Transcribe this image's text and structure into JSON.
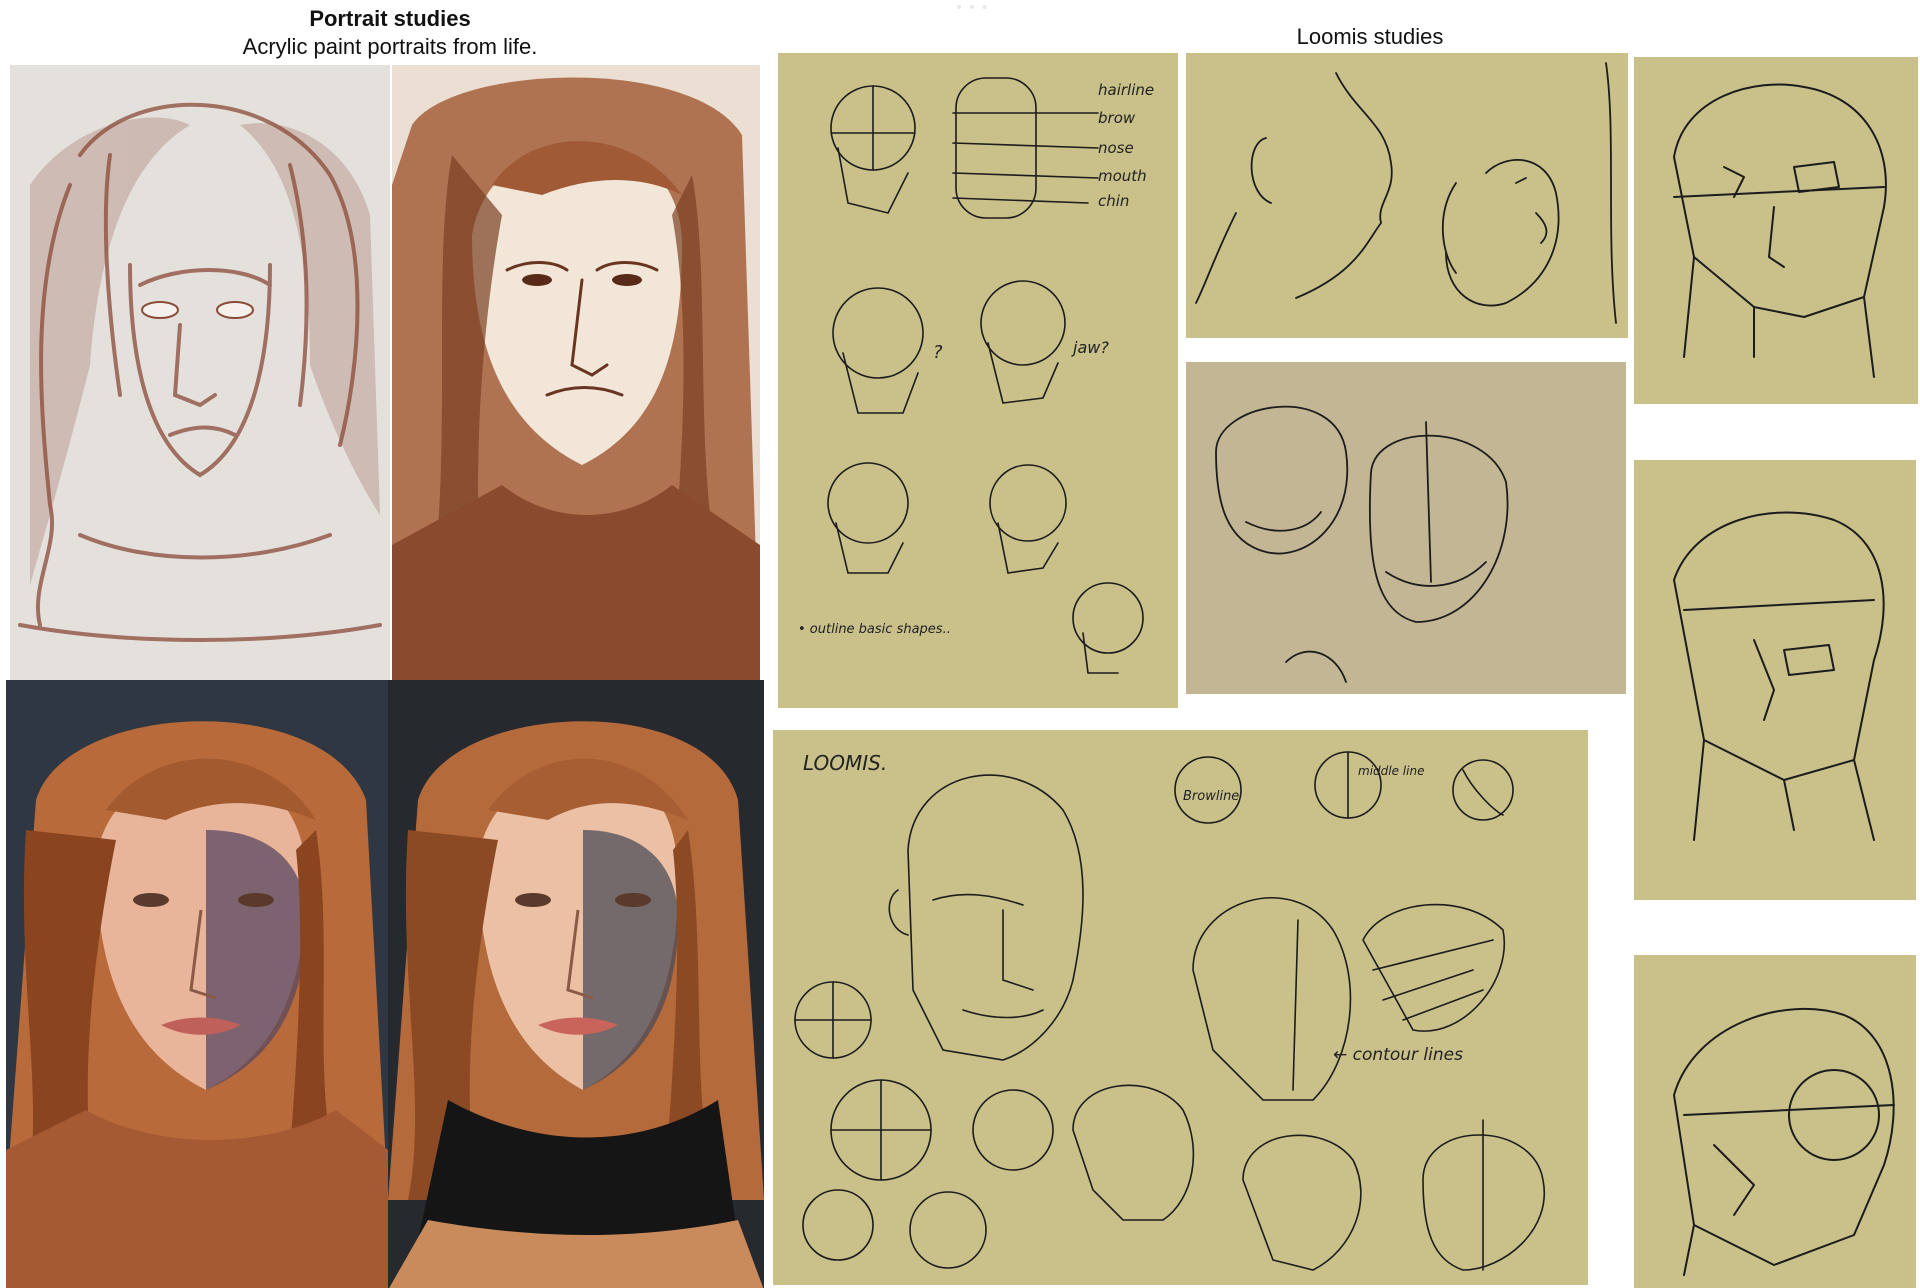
{
  "portrait_section": {
    "title": "Portrait studies",
    "subtitle": "Acrylic paint portraits from life."
  },
  "loomis_section": {
    "title": "Loomis studies"
  },
  "sketch_notes": {
    "labels_1": [
      "hairline",
      "brow",
      "nose",
      "mouth",
      "chin"
    ],
    "note_question": "?",
    "note_jaw": "jaw?",
    "note_outline": "• outline basic shapes..",
    "loomis_heading": "LOOMIS.",
    "browline": "Browline",
    "middle_line": "middle line",
    "contour_lines": "← contour lines"
  },
  "colors": {
    "paper": "#c9c08a",
    "sienna": "#8a4a2e",
    "ink": "#1c1c1c"
  }
}
